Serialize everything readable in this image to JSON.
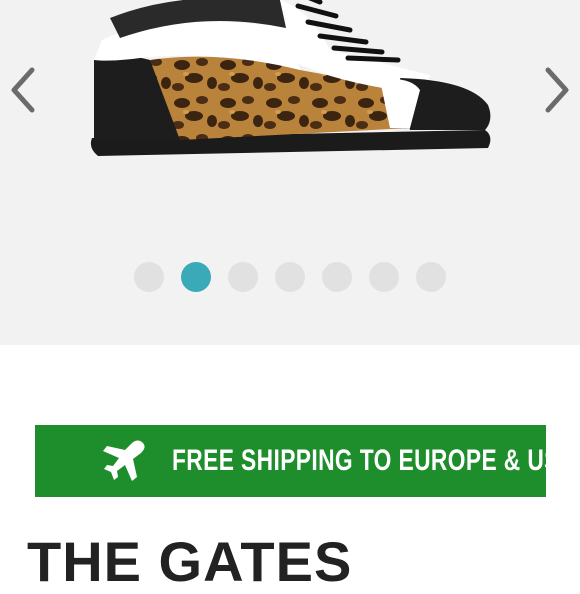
{
  "gallery": {
    "image_alt": "Leopard print high-top sneaker",
    "prev_icon": "chevron-left-icon",
    "next_icon": "chevron-right-icon",
    "dots_count": 7,
    "active_index": 1
  },
  "banner": {
    "text": "FREE SHIPPING TO EUROPE & US",
    "icon": "airplane-icon",
    "color": "#1e8e2c"
  },
  "product": {
    "title": "THE GATES"
  },
  "colors": {
    "accent": "#3aa9b8",
    "inactive_dot": "#e1e1e1"
  }
}
